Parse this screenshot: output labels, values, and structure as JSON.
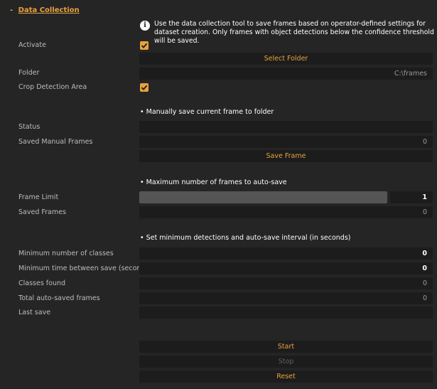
{
  "header": {
    "collapse_symbol": "-",
    "title": "Data Collection"
  },
  "info": {
    "icon": "info-icon",
    "glyph": "i",
    "text": "Use the data collection tool to save frames based on operator-defined settings for dataset creation. Only frames with object detections below the confidence threshold will be saved."
  },
  "activate": {
    "label": "Activate",
    "checked": true
  },
  "select_folder": {
    "label": "Select Folder"
  },
  "folder": {
    "label": "Folder",
    "value": "C:\\frames"
  },
  "crop": {
    "label": "Crop Detection Area",
    "checked": true
  },
  "manual": {
    "section": "• Manually save current frame to folder",
    "status_label": "Status",
    "status_value": "",
    "saved_label": "Saved Manual Frames",
    "saved_value": "0",
    "save_button": "Save Frame"
  },
  "autosave_limit": {
    "section": "• Maximum number of frames to auto-save",
    "frame_limit_label": "Frame Limit",
    "frame_limit_value": "1",
    "saved_frames_label": "Saved Frames",
    "saved_frames_value": "0"
  },
  "detections": {
    "section": "• Set minimum detections and auto-save interval (in seconds)",
    "min_classes_label": "Minimum number of classes",
    "min_classes_value": "0",
    "min_time_label": "Minimum time between save (seconds)",
    "min_time_value": "0",
    "classes_found_label": "Classes found",
    "classes_found_value": "0",
    "total_auto_label": "Total auto-saved frames",
    "total_auto_value": "0",
    "last_save_label": "Last save",
    "last_save_value": ""
  },
  "controls": {
    "start": "Start",
    "stop": "Stop",
    "reset": "Reset"
  },
  "colors": {
    "accent": "#e8a33c",
    "background": "#252525",
    "field": "#1c1c1c",
    "slider": "#555555"
  }
}
